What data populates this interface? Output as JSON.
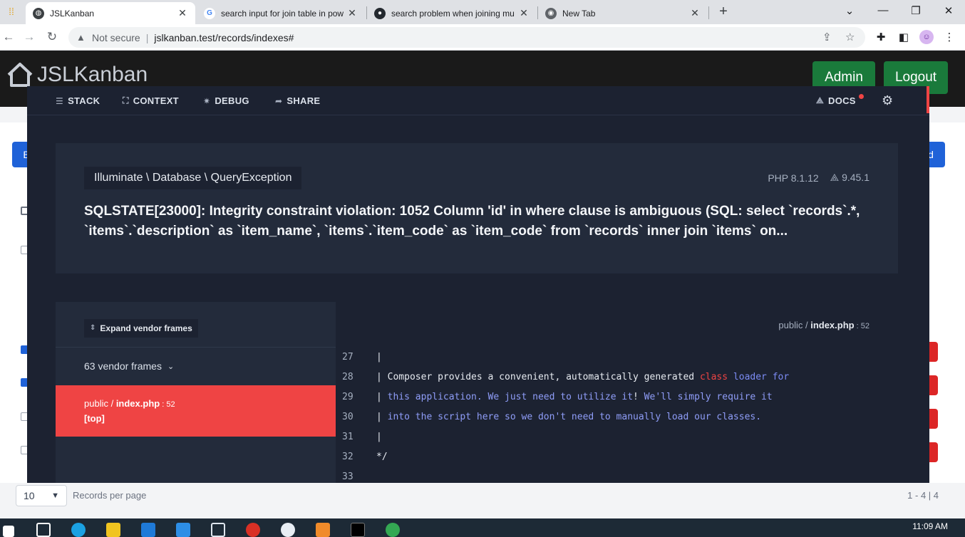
{
  "browser": {
    "tabs": [
      {
        "title": "JSLKanban",
        "favicon": "globe-icon",
        "active": true
      },
      {
        "title": "search input for join table in pow",
        "favicon": "google-icon",
        "active": false
      },
      {
        "title": "search problem when joining mu",
        "favicon": "github-icon",
        "active": false
      },
      {
        "title": "New Tab",
        "favicon": "chrome-icon",
        "active": false
      }
    ],
    "security_label": "Not secure",
    "url": "jslkanban.test/records/indexes#"
  },
  "app": {
    "brand": "JSLKanban",
    "admin_label": "Admin",
    "logout_label": "Logout",
    "records_per_page_value": "10",
    "records_per_page_label": "Records per page",
    "pagination_count": "1 - 4 | 4",
    "peek_left_btn": "B",
    "peek_right_btn": "d"
  },
  "ignition": {
    "nav": {
      "stack": "STACK",
      "context": "CONTEXT",
      "debug": "DEBUG",
      "share": "SHARE",
      "docs": "DOCS"
    },
    "exception": {
      "class": "Illuminate \\ Database \\ QueryException",
      "php_version": "PHP 8.1.12",
      "laravel_version": "9.45.1",
      "message": "SQLSTATE[23000]: Integrity constraint violation: 1052 Column 'id' in where clause is ambiguous (SQL: select `records`.*, `items`.`description` as `item_name`, `items`.`item_code` as `item_code` from `records` inner join `items` on..."
    },
    "frames": {
      "expand_label": "Expand vendor frames",
      "vendor_frames": "63 vendor frames",
      "active_frame_dir": "public / ",
      "active_frame_file": "index.php",
      "active_frame_line": " : 52",
      "active_frame_tag": "[top]"
    },
    "code": {
      "file_dir": "public / ",
      "file_name": "index.php",
      "file_line": " : 52",
      "lines": [
        {
          "num": "27",
          "parts": [
            {
              "t": "|",
              "c": "c-pl"
            }
          ]
        },
        {
          "num": "28",
          "parts": [
            {
              "t": "| Composer provides a convenient, automatically generated ",
              "c": "c-pl"
            },
            {
              "t": "class",
              "c": "c-kw"
            },
            {
              "t": " loader for",
              "c": "c-ty"
            }
          ]
        },
        {
          "num": "29",
          "parts": [
            {
              "t": "| ",
              "c": "c-pl"
            },
            {
              "t": "this application. We just need to utilize it",
              "c": "c-cm"
            },
            {
              "t": "!",
              "c": "c-pl"
            },
            {
              "t": " We'll simply require it",
              "c": "c-cm"
            }
          ]
        },
        {
          "num": "30",
          "parts": [
            {
              "t": "| ",
              "c": "c-pl"
            },
            {
              "t": "into the script here so we don't need to manually load our classes.",
              "c": "c-cm"
            }
          ]
        },
        {
          "num": "31",
          "parts": [
            {
              "t": "|",
              "c": "c-pl"
            }
          ]
        },
        {
          "num": "32",
          "parts": [
            {
              "t": "*/",
              "c": "c-pl"
            }
          ]
        },
        {
          "num": "33",
          "parts": [
            {
              "t": "",
              "c": "c-pl"
            }
          ]
        }
      ]
    }
  },
  "taskbar": {
    "time": "11:09 AM"
  },
  "colors": {
    "overlay_bg": "#1c2231",
    "card_bg": "#232b3b",
    "accent_red": "#ef4444",
    "app_green": "#1a7a3b"
  }
}
